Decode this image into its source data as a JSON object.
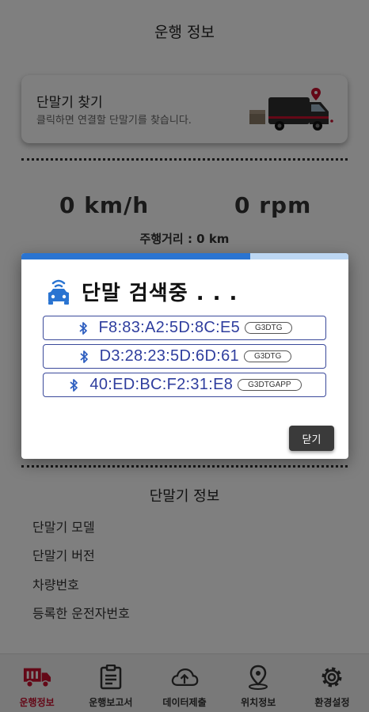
{
  "header": {
    "title": "운행 정보"
  },
  "finder": {
    "title": "단말기 찾기",
    "description": "클릭하면 연결할 단말기를 찾습니다."
  },
  "stats": {
    "speed": "0 km/h",
    "rpm": "0 rpm",
    "distance": "주행거리 : 0 km"
  },
  "device_info": {
    "title": "단말기 정보",
    "items": [
      "단말기 모델",
      "단말기 버전",
      "차량번호",
      "등록한 운전자번호"
    ]
  },
  "dialog": {
    "title": "단말 검색중 . . .",
    "progress": 0.7,
    "devices": [
      {
        "mac": "F8:83:A2:5D:8C:E5",
        "name": "G3DTG"
      },
      {
        "mac": "D3:28:23:5D:6D:61",
        "name": "G3DTG"
      },
      {
        "mac": "40:ED:BC:F2:31:E8",
        "name": "G3DTGAPP"
      }
    ],
    "close_label": "닫기"
  },
  "nav": {
    "items": [
      {
        "label": "운행정보",
        "icon": "truck-icon",
        "active": true
      },
      {
        "label": "운행보고서",
        "icon": "clipboard-icon",
        "active": false
      },
      {
        "label": "데이터제출",
        "icon": "cloud-upload-icon",
        "active": false
      },
      {
        "label": "위치정보",
        "icon": "location-pin-icon",
        "active": false
      },
      {
        "label": "환경설정",
        "icon": "gear-icon",
        "active": false
      }
    ]
  },
  "colors": {
    "accent": "#c8102e",
    "bluetooth": "#2f3e9e",
    "progress": "#2a74d1"
  }
}
